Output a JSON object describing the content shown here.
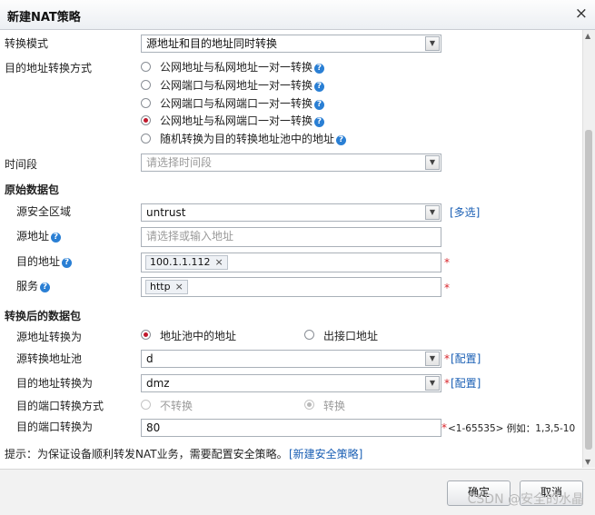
{
  "dialog": {
    "title": "新建NAT策略",
    "close": "×"
  },
  "conv_mode": {
    "label": "转换模式",
    "value": "源地址和目的地址同时转换"
  },
  "dst_method": {
    "label": "目的地址转换方式",
    "options": [
      {
        "label": "公网地址与私网地址一对一转换",
        "selected": false
      },
      {
        "label": "公网端口与私网地址一对一转换",
        "selected": false
      },
      {
        "label": "公网端口与私网端口一对一转换",
        "selected": false
      },
      {
        "label": "公网地址与私网端口一对一转换",
        "selected": true
      },
      {
        "label": "随机转换为目的转换地址池中的地址",
        "selected": false
      }
    ]
  },
  "time": {
    "label": "时间段",
    "placeholder": "请选择时间段"
  },
  "orig": {
    "title": "原始数据包",
    "src_zone": {
      "label": "源安全区域",
      "value": "untrust",
      "link": "[多选]"
    },
    "src_addr": {
      "label": "源地址",
      "placeholder": "请选择或输入地址"
    },
    "dst_addr": {
      "label": "目的地址",
      "tag": "100.1.1.112"
    },
    "service": {
      "label": "服务",
      "tag": "http"
    }
  },
  "after": {
    "title": "转换后的数据包",
    "src_conv": {
      "label": "源地址转换为",
      "opt1": "地址池中的地址",
      "opt2": "出接口地址"
    },
    "src_pool": {
      "label": "源转换地址池",
      "value": "d",
      "link": "[配置]"
    },
    "dst_conv": {
      "label": "目的地址转换为",
      "value": "dmz",
      "link": "[配置]"
    },
    "port_method": {
      "label": "目的端口转换方式",
      "opt1": "不转换",
      "opt2": "转换"
    },
    "dst_port": {
      "label": "目的端口转换为",
      "value": "80",
      "hint": "<1-65535> 例如：1,3,5-10"
    }
  },
  "tip": {
    "text": "提示：为保证设备顺利转发NAT业务，需要配置安全策略。",
    "link": "[新建安全策略]"
  },
  "buttons": {
    "ok": "确定",
    "cancel": "取消"
  },
  "watermark": "CSDN @安全的水晶",
  "glyphs": {
    "arrow": "▼",
    "q": "?",
    "x": "×",
    "star": "*"
  },
  "icons": [
    "close-icon",
    "dropdown-arrow-icon",
    "help-icon",
    "tag-remove-icon"
  ]
}
